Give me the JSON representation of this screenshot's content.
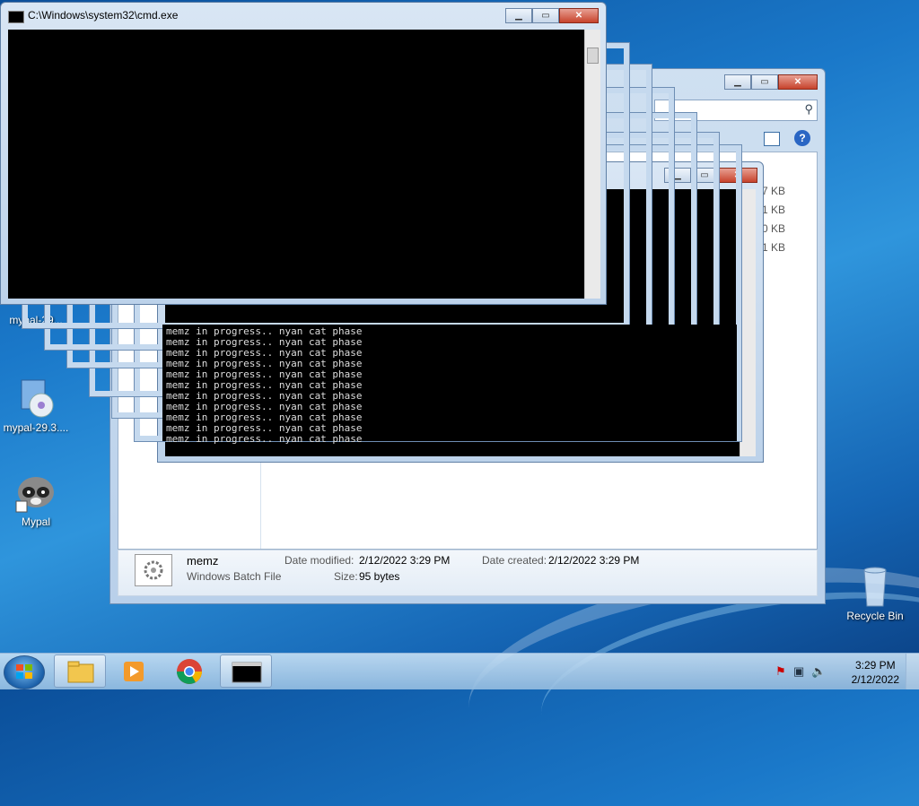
{
  "desktop": {
    "icons": [
      {
        "label": "mypal-29..."
      },
      {
        "label": "mypal-29.3...."
      },
      {
        "label": "Mypal"
      },
      {
        "label": "Recycle Bin"
      }
    ]
  },
  "cmd_window": {
    "title": "C:\\Windows\\system32\\cmd.exe"
  },
  "console_lines": [
    "memz in progress.. nyan cat phase",
    "memz in progress.. nyan cat phase",
    "memz in progress.. nyan cat phase",
    "memz in progress.. nyan cat phase",
    "memz in progress.. nyan cat phase",
    "memz in progress.. nyan cat phase",
    "memz in progress.. nyan cat phase",
    "memz in progress.. nyan cat phase",
    "memz in progress.. nyan cat phase",
    "memz in progress.. nyan cat phase",
    "memz in progress.. nyan cat phase"
  ],
  "explorer": {
    "sizes": [
      "7 KB",
      "1 KB",
      "0 KB",
      "1 KB"
    ],
    "details": {
      "name": "memz",
      "type": "Windows Batch File",
      "date_modified_label": "Date modified:",
      "date_modified": "2/12/2022 3:29 PM",
      "date_created_label": "Date created:",
      "date_created": "2/12/2022 3:29 PM",
      "size_label": "Size:",
      "size": "95 bytes"
    }
  },
  "taskbar": {
    "time": "3:29 PM",
    "date": "2/12/2022"
  }
}
